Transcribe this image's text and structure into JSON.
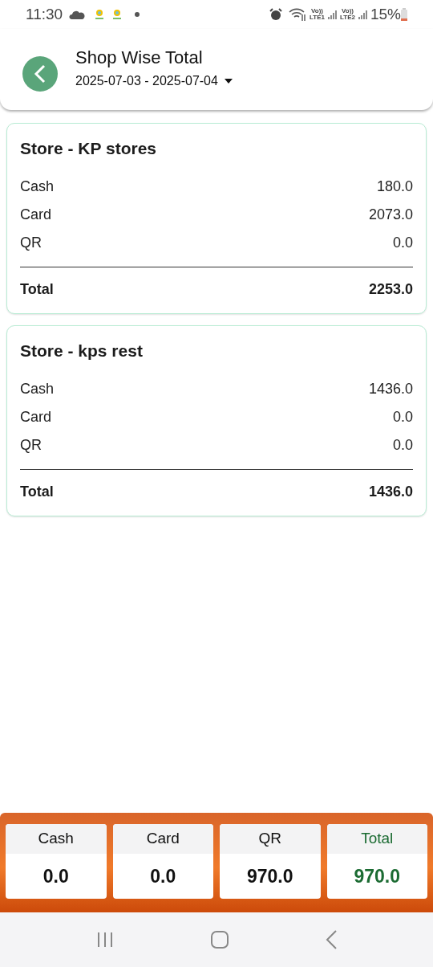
{
  "status_bar": {
    "time": "11:30",
    "sim_labels": [
      {
        "top": "Vo))",
        "bottom": "LTE1"
      },
      {
        "top": "Vo))",
        "bottom": "LTE2"
      }
    ],
    "battery": "15%"
  },
  "header": {
    "title": "Shop Wise Total",
    "date_range": "2025-07-03 - 2025-07-04"
  },
  "stores": [
    {
      "title": "Store - KP stores",
      "rows": [
        {
          "label": "Cash",
          "value": "180.0"
        },
        {
          "label": "Card",
          "value": "2073.0"
        },
        {
          "label": "QR",
          "value": "0.0"
        }
      ],
      "total_label": "Total",
      "total": "2253.0"
    },
    {
      "title": "Store - kps rest",
      "rows": [
        {
          "label": "Cash",
          "value": "1436.0"
        },
        {
          "label": "Card",
          "value": "0.0"
        },
        {
          "label": "QR",
          "value": "0.0"
        }
      ],
      "total_label": "Total",
      "total": "1436.0"
    }
  ],
  "summary": [
    {
      "kind": "plain",
      "label": "Cash",
      "value": "0.0"
    },
    {
      "kind": "plain",
      "label": "Card",
      "value": "0.0"
    },
    {
      "kind": "plain",
      "label": "QR",
      "value": "970.0"
    },
    {
      "kind": "total",
      "label": "Total",
      "value": "970.0"
    }
  ]
}
